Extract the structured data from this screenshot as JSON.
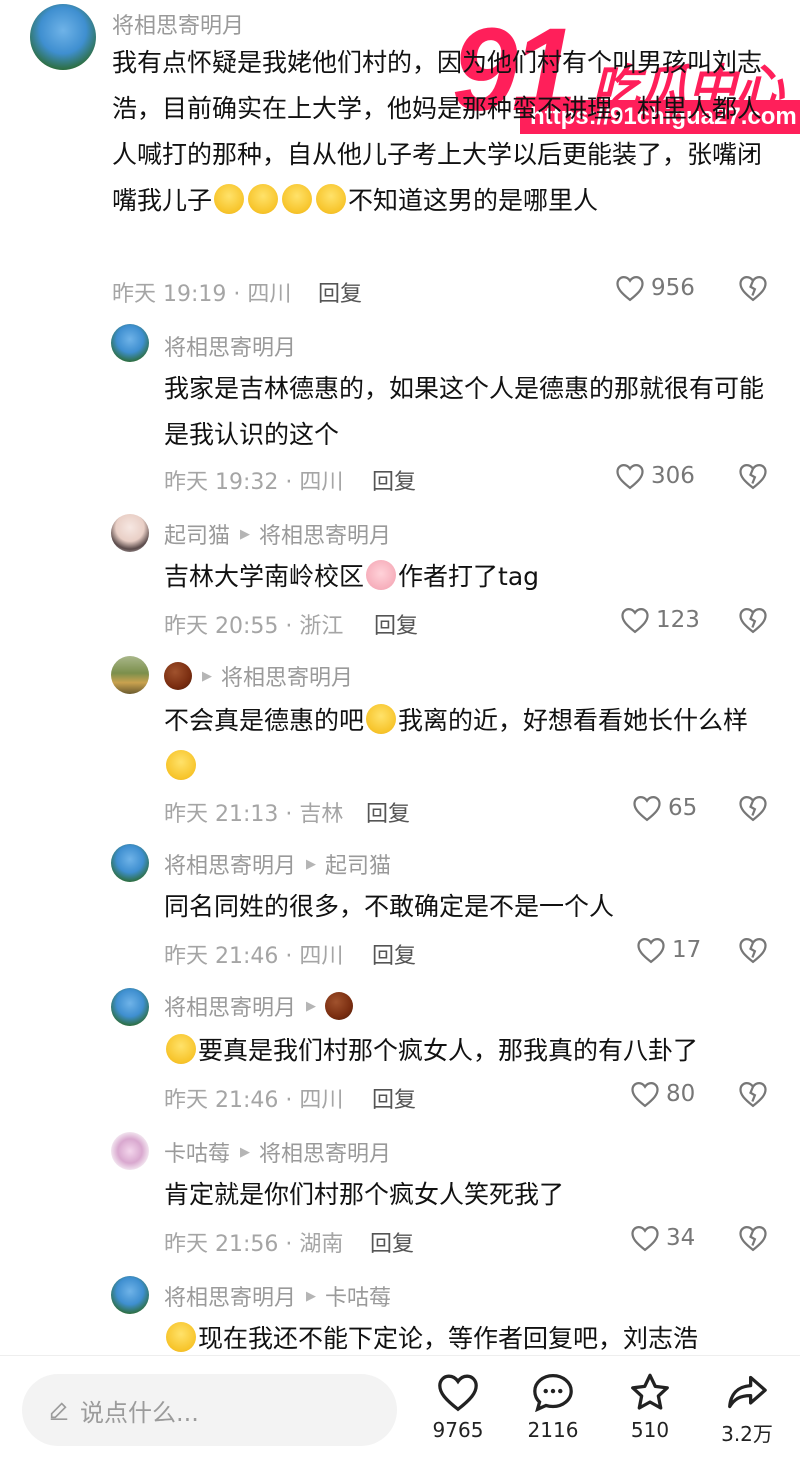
{
  "watermark": {
    "number": "91",
    "name": "吃瓜中心",
    "url": "https://91chigua27.com"
  },
  "comments": [
    {
      "author": "将相思寄明月",
      "text_parts": [
        "我有点怀疑是我姥他们村的，因为他们村有个叫男孩叫刘志浩，目前确实在上大学，他妈是那种蛮不讲理，村里人都人人喊打的那种，自从他儿子考上大学以后更能装了，张嘴闭嘴我儿子",
        "不知道这男的是哪里人"
      ],
      "emoji": "crying-laughing-emoji",
      "time": "昨天 19:19 · 四川",
      "reply": "回复",
      "likes": "956"
    },
    {
      "author": "将相思寄明月",
      "text": "我家是吉林德惠的，如果这个人是德惠的那就很有可能是我认识的这个",
      "time": "昨天 19:32 · 四川",
      "reply": "回复",
      "likes": "306"
    },
    {
      "author": "起司猫",
      "reply_to": "将相思寄明月",
      "text_parts": [
        "吉林大学南岭校区",
        "作者打了tag"
      ],
      "emoji": "pig-emoji",
      "time": "昨天 20:55 · 浙江",
      "reply": "回复",
      "likes": "123"
    },
    {
      "author": "",
      "reply_to": "将相思寄明月",
      "text_parts": [
        "不会真是德惠的吧",
        "我离的近，好想看看她长什么样"
      ],
      "emoji": "curious-emoji",
      "time": "昨天 21:13 · 吉林",
      "reply": "回复",
      "likes": "65"
    },
    {
      "author": "将相思寄明月",
      "reply_to": "起司猫",
      "text": "同名同姓的很多，不敢确定是不是一个人",
      "time": "昨天 21:46 · 四川",
      "reply": "回复",
      "likes": "17"
    },
    {
      "author": "将相思寄明月",
      "reply_to": "",
      "text": "要真是我们村那个疯女人，那我真的有八卦了",
      "emoji": "smug-emoji",
      "time": "昨天 21:46 · 四川",
      "reply": "回复",
      "likes": "80"
    },
    {
      "author": "卡咕莓",
      "reply_to": "将相思寄明月",
      "text": "肯定就是你们村那个疯女人笑死我了",
      "time": "昨天 21:56 · 湖南",
      "reply": "回复",
      "likes": "34"
    },
    {
      "author": "将相思寄明月",
      "reply_to": "卡咕莓",
      "text": "现在我还不能下定论，等作者回复吧，刘志浩",
      "emoji": "crying-laughing-emoji"
    }
  ],
  "bottom_bar": {
    "input_placeholder": "说点什么...",
    "like_count": "9765",
    "comment_count": "2116",
    "favorite_count": "510",
    "share_count": "3.2万"
  },
  "colors": {
    "watermark": "#ff1f5a",
    "meta_gray": "#a5a5a5",
    "name_gray": "#9a9a9a"
  }
}
